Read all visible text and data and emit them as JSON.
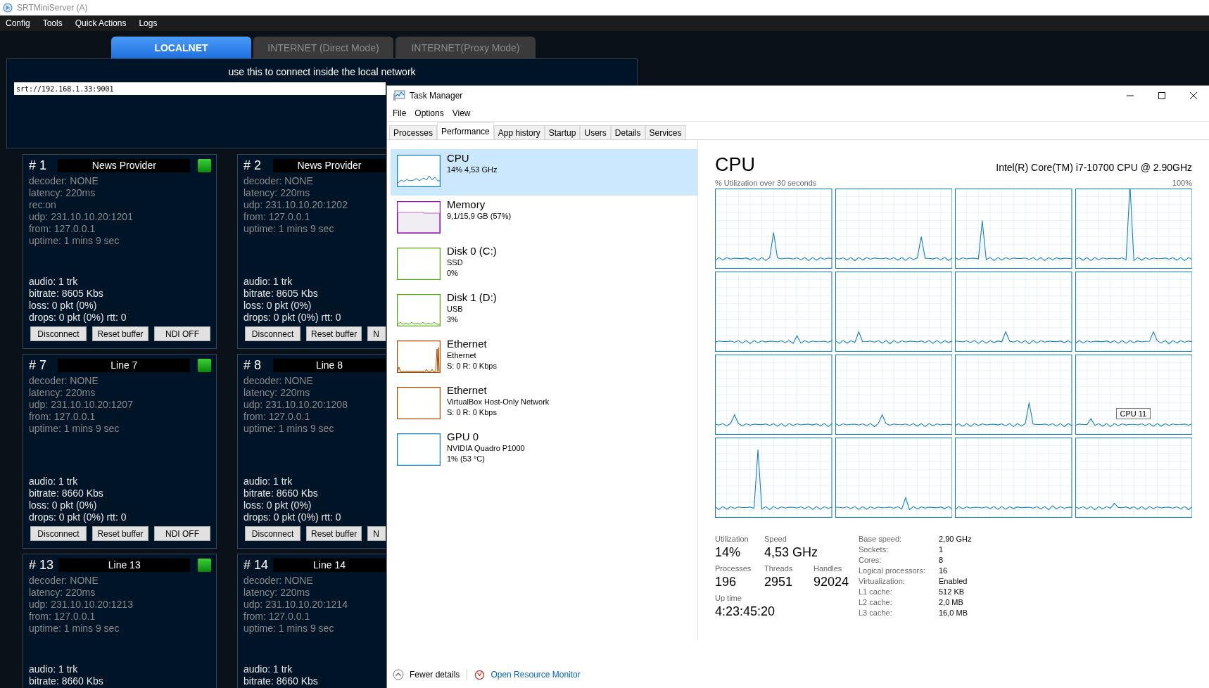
{
  "app": {
    "title": "SRTMiniServer (A)",
    "menu": [
      "Config",
      "Tools",
      "Quick Actions",
      "Logs"
    ],
    "tabs": [
      {
        "label": "LOCALNET",
        "selected": true
      },
      {
        "label": "INTERNET (Direct Mode)",
        "selected": false
      },
      {
        "label": "INTERNET(Proxy Mode)",
        "selected": false
      }
    ],
    "connect_hint": "use this to connect inside the local network",
    "url_value": "srt://192.168.1.33:9001",
    "cards": [
      {
        "number": "# 1",
        "name": "News Provider",
        "status_light": true,
        "info": [
          "decoder: NONE",
          "latency: 220ms",
          "rec:on",
          "udp: 231.10.10.20:1201",
          "from: 127.0.0.1",
          "uptime:  1 mins 9 sec"
        ],
        "stats": [
          "audio: 1 trk",
          "bitrate: 8605 Kbs",
          "loss: 0 pkt (0%)",
          "drops: 0 pkt (0%) rtt: 0"
        ],
        "buttons": [
          "Disconnect",
          "Reset buffer",
          "NDI OFF"
        ]
      },
      {
        "number": "# 2",
        "name": "News Provider",
        "info": [
          "decoder: NONE",
          "latency: 220ms",
          "udp: 231.10.10.20:1202",
          "from: 127.0.0.1",
          "uptime:  1 mins 9 sec"
        ],
        "stats": [
          "audio: 1 trk",
          "bitrate: 8605 Kbs",
          "loss: 0 pkt (0%)",
          "drops: 0 pkt (0%) rtt: 0"
        ],
        "buttons": [
          "Disconnect",
          "Reset buffer",
          "N"
        ]
      },
      {
        "number": "# 7",
        "name": "Line 7",
        "status_light": true,
        "info": [
          "decoder: NONE",
          "latency: 220ms",
          "udp: 231.10.10.20:1207",
          "from: 127.0.0.1",
          "uptime:  1 mins 9 sec"
        ],
        "stats": [
          "audio: 1 trk",
          "bitrate: 8660 Kbs",
          "loss: 0 pkt (0%)",
          "drops: 0 pkt (0%) rtt: 0"
        ],
        "buttons": [
          "Disconnect",
          "Reset buffer",
          "NDI OFF"
        ]
      },
      {
        "number": "# 8",
        "name": "Line 8",
        "info": [
          "decoder: NONE",
          "latency: 220ms",
          "udp: 231.10.10.20:1208",
          "from: 127.0.0.1",
          "uptime:  1 mins 9 sec"
        ],
        "stats": [
          "audio: 1 trk",
          "bitrate: 8660 Kbs",
          "loss: 0 pkt (0%)",
          "drops: 0 pkt (0%) rtt: 0"
        ],
        "buttons": [
          "Disconnect",
          "Reset buffer",
          "N"
        ]
      },
      {
        "number": "# 13",
        "name": "Line 13",
        "status_light": true,
        "info": [
          "decoder: NONE",
          "latency: 220ms",
          "udp: 231.10.10.20:1213",
          "from: 127.0.0.1",
          "uptime:  1 mins 9 sec"
        ],
        "stats": [
          "audio: 1 trk",
          "bitrate: 8660 Kbs"
        ]
      },
      {
        "number": "# 14",
        "name": "Line 14",
        "info": [
          "decoder: NONE",
          "latency: 220ms",
          "udp: 231.10.10.20:1214",
          "from: 127.0.0.1",
          "uptime:  1 mins 9 sec"
        ],
        "stats": [
          "audio: 1 trk",
          "bitrate: 8660 Kbs"
        ]
      }
    ]
  },
  "task_manager": {
    "title": "Task Manager",
    "menu": [
      "File",
      "Options",
      "View"
    ],
    "tabs": [
      {
        "label": "Processes",
        "selected": false
      },
      {
        "label": "Performance",
        "selected": true
      },
      {
        "label": "App history",
        "selected": false
      },
      {
        "label": "Startup",
        "selected": false
      },
      {
        "label": "Users",
        "selected": false
      },
      {
        "label": "Details",
        "selected": false
      },
      {
        "label": "Services",
        "selected": false
      }
    ],
    "resources": [
      {
        "kind": "cpu",
        "selected": true,
        "title": "CPU",
        "lines": [
          "14% 4,53 GHz"
        ]
      },
      {
        "kind": "memory",
        "selected": false,
        "title": "Memory",
        "lines": [
          "9,1/15,9 GB (57%)"
        ]
      },
      {
        "kind": "disk",
        "selected": false,
        "title": "Disk 0 (C:)",
        "lines": [
          "SSD",
          "0%"
        ]
      },
      {
        "kind": "disk-busy",
        "selected": false,
        "title": "Disk 1 (D:)",
        "lines": [
          "USB",
          "3%"
        ]
      },
      {
        "kind": "ethernet-busy",
        "selected": false,
        "title": "Ethernet",
        "lines": [
          "Ethernet",
          "S: 0 R: 0 Kbps"
        ]
      },
      {
        "kind": "ethernet",
        "selected": false,
        "title": "Ethernet",
        "lines": [
          "VirtualBox Host-Only Network",
          "S: 0 R: 0 Kbps"
        ]
      },
      {
        "kind": "gpu",
        "selected": false,
        "title": "GPU 0",
        "lines": [
          "NVIDIA Quadro P1000",
          "1% (53 °C)"
        ]
      }
    ],
    "detail": {
      "title": "CPU",
      "model": "Intel(R) Core(TM) i7-10700 CPU @ 2.90GHz",
      "graph_caption": "% Utilization over 30 seconds",
      "graph_max": "100%",
      "graphs": [
        {
          "kind": "core"
        },
        {
          "kind": "core"
        },
        {
          "kind": "core"
        },
        {
          "kind": "core"
        },
        {
          "kind": "core"
        },
        {
          "kind": "core"
        },
        {
          "kind": "core"
        },
        {
          "kind": "core"
        },
        {
          "kind": "core"
        },
        {
          "kind": "core"
        },
        {
          "kind": "core"
        },
        {
          "kind": "core",
          "tooltip": "CPU 11"
        },
        {
          "kind": "core"
        },
        {
          "kind": "core"
        },
        {
          "kind": "core"
        },
        {
          "kind": "core"
        }
      ],
      "stat_rows": [
        [
          {
            "label": "Utilization",
            "value": "14%"
          },
          {
            "label": "Speed",
            "value": "4,53 GHz"
          }
        ],
        [
          {
            "label": "Processes",
            "value": "196"
          },
          {
            "label": "Threads",
            "value": "2951"
          },
          {
            "label": "Handles",
            "value": "92024"
          }
        ],
        [
          {
            "label": "Up time",
            "value": "4:23:45:20"
          }
        ]
      ],
      "specs": [
        {
          "label": "Base speed:",
          "value": "2,90 GHz"
        },
        {
          "label": "Sockets:",
          "value": "1"
        },
        {
          "label": "Cores:",
          "value": "8"
        },
        {
          "label": "Logical processors:",
          "value": "16"
        },
        {
          "label": "Virtualization:",
          "value": "Enabled"
        },
        {
          "label": "L1 cache:",
          "value": "512 KB"
        },
        {
          "label": "L2 cache:",
          "value": "2,0 MB"
        },
        {
          "label": "L3 cache:",
          "value": "16,0 MB"
        }
      ]
    },
    "footer": {
      "fewer_details": "Fewer details",
      "resource_monitor": "Open Resource Monitor"
    }
  }
}
